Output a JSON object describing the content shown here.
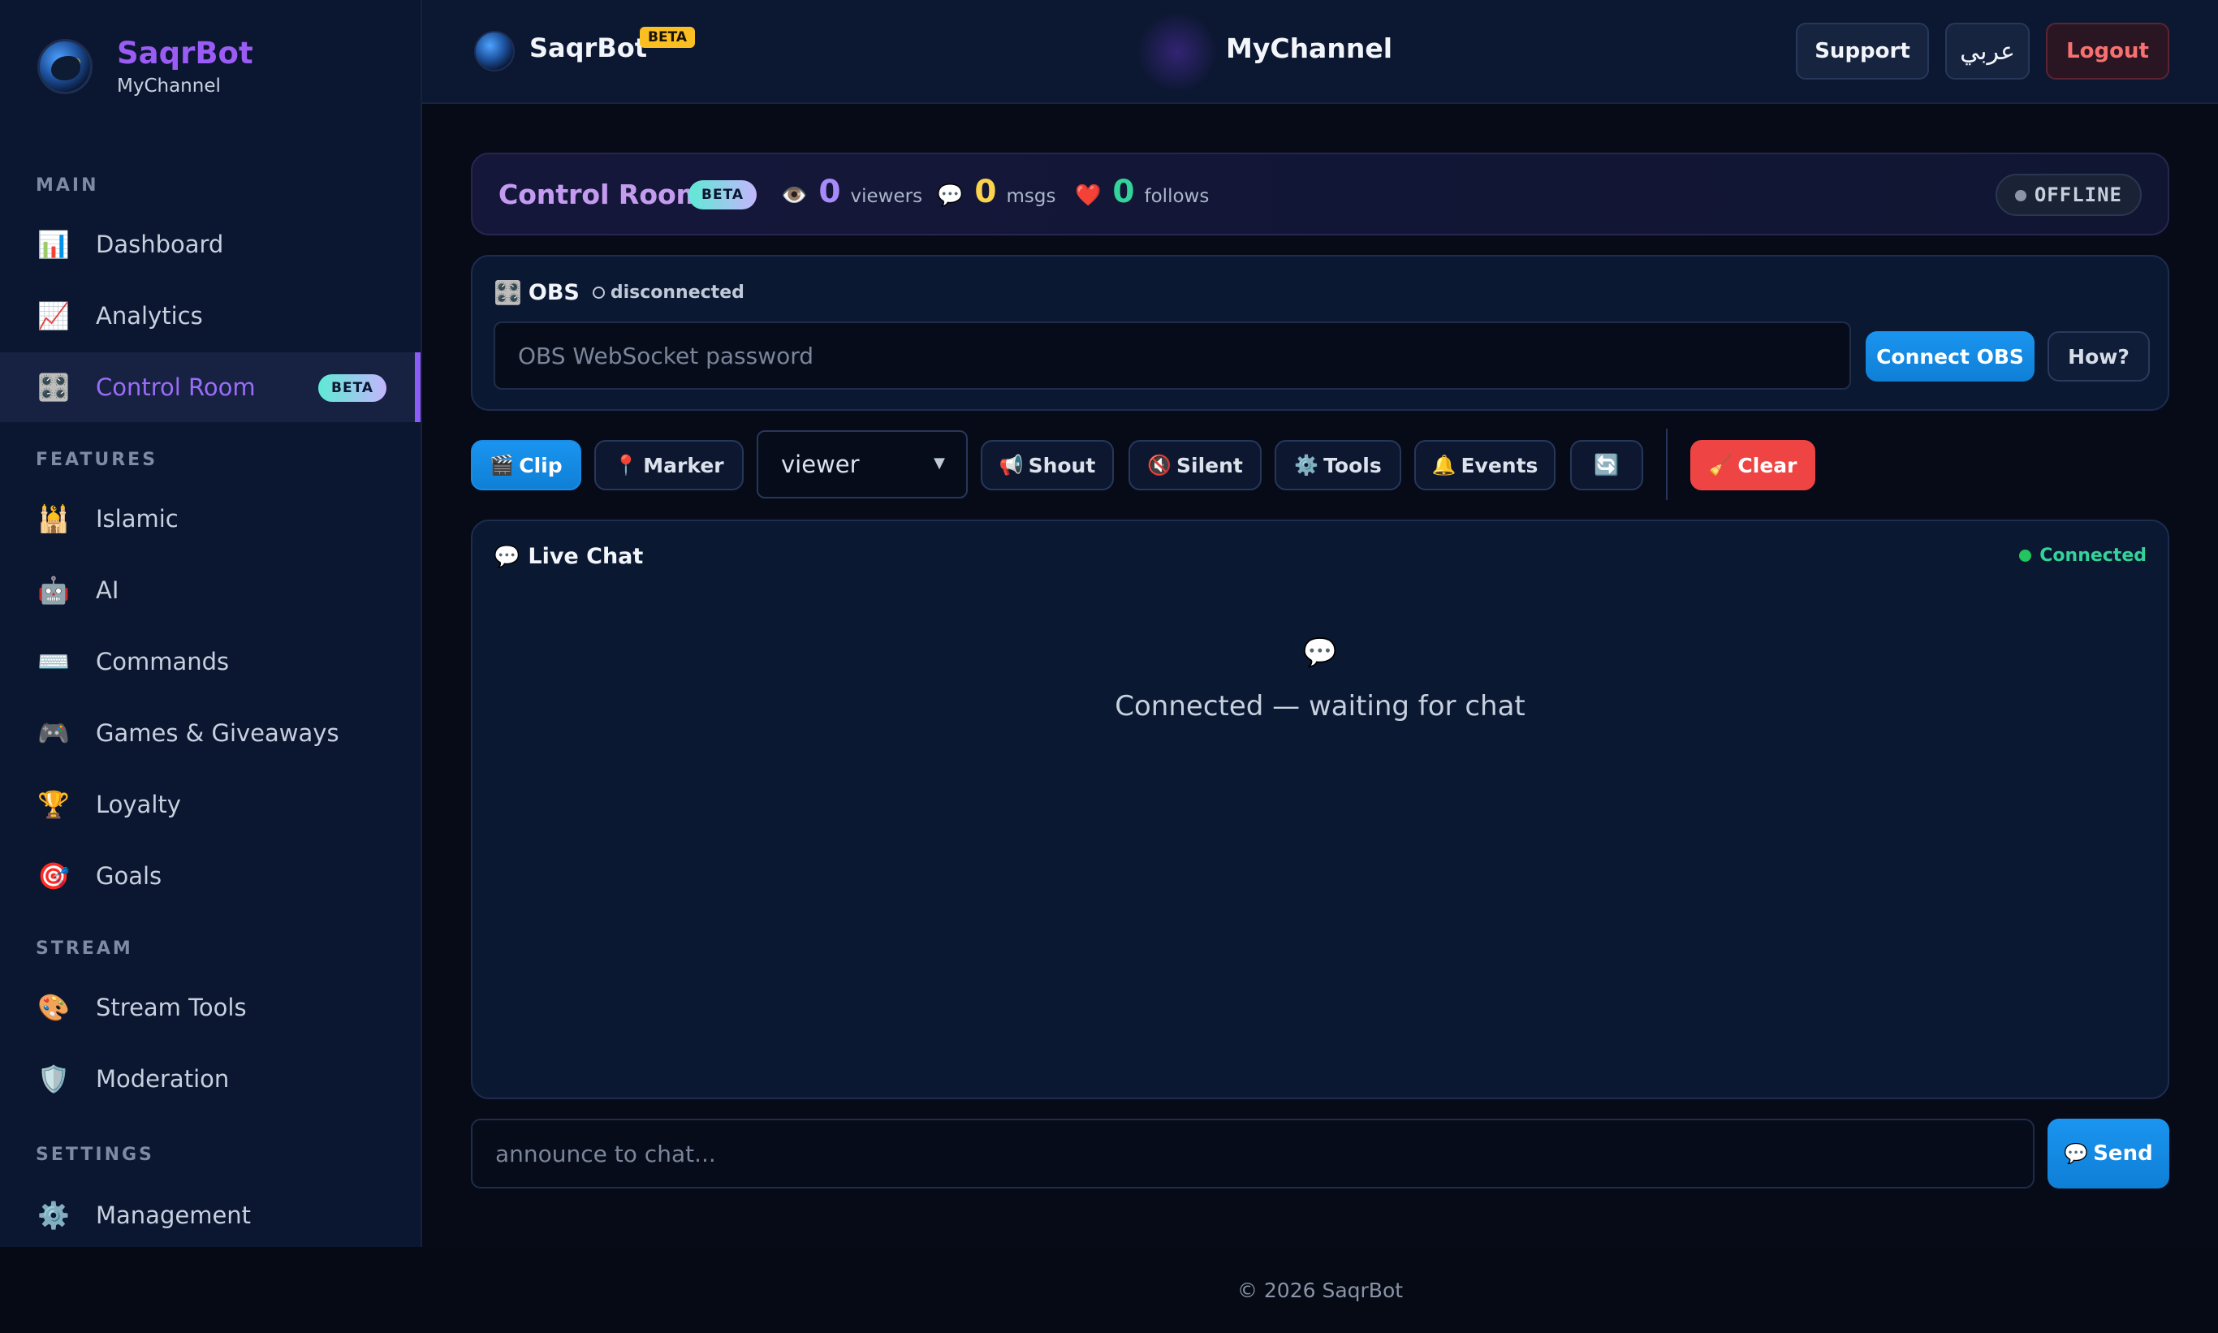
{
  "brand": {
    "name": "SaqrBot",
    "channel": "MyChannel"
  },
  "sidebar": {
    "sections": [
      {
        "label": "MAIN"
      },
      {
        "label": "FEATURES"
      },
      {
        "label": "STREAM"
      },
      {
        "label": "SETTINGS"
      }
    ],
    "items": [
      {
        "label": "Dashboard",
        "icon": "📊"
      },
      {
        "label": "Analytics",
        "icon": "📈"
      },
      {
        "label": "Control Room",
        "icon": "🎛️",
        "badge": "BETA",
        "active": true
      },
      {
        "label": "Islamic",
        "icon": "🕌"
      },
      {
        "label": "AI",
        "icon": "🤖"
      },
      {
        "label": "Commands",
        "icon": "⌨️"
      },
      {
        "label": "Games & Giveaways",
        "icon": "🎮"
      },
      {
        "label": "Loyalty",
        "icon": "🏆"
      },
      {
        "label": "Goals",
        "icon": "🎯"
      },
      {
        "label": "Stream Tools",
        "icon": "🎨"
      },
      {
        "label": "Moderation",
        "icon": "🛡️"
      },
      {
        "label": "Management",
        "icon": "⚙️"
      }
    ]
  },
  "topbar": {
    "app_name": "SaqrBot",
    "beta": "BETA",
    "channel": "MyChannel",
    "support_label": "Support",
    "lang_label": "عربي",
    "logout_label": "Logout"
  },
  "control_room": {
    "title": "Control Room",
    "badge": "BETA",
    "stats": [
      {
        "icon": "👁️",
        "value": "0",
        "label": "viewers",
        "color": "#a78bfa"
      },
      {
        "icon": "💬",
        "value": "0",
        "label": "msgs",
        "color": "#fcd34d"
      },
      {
        "icon": "❤️",
        "value": "0",
        "label": "follows",
        "color": "#34d399"
      }
    ],
    "status": "OFFLINE"
  },
  "obs": {
    "icon": "🎛️",
    "title": "OBS",
    "status": "disconnected",
    "password_placeholder": "OBS WebSocket password",
    "connect_label": "Connect OBS",
    "how_label": "How?"
  },
  "toolbar": {
    "clip": {
      "icon": "🎬",
      "label": "Clip"
    },
    "marker": {
      "icon": "📍",
      "label": "Marker"
    },
    "role_select": "viewer",
    "shout": {
      "icon": "📢",
      "label": "Shout"
    },
    "silent": {
      "icon": "🔇",
      "label": "Silent"
    },
    "tools": {
      "icon": "⚙️",
      "label": "Tools"
    },
    "events": {
      "icon": "🔔",
      "label": "Events"
    },
    "refresh_icon": "🔄",
    "clear": {
      "icon": "🧹",
      "label": "Clear"
    }
  },
  "chat": {
    "icon": "💬",
    "title": "Live Chat",
    "status": "Connected",
    "empty_icon": "💬",
    "empty_text": "Connected — waiting for chat",
    "announce_placeholder": "announce to chat...",
    "send_icon": "💬",
    "send_label": "Send"
  },
  "footer": {
    "text": "© 2026 SaqrBot"
  }
}
